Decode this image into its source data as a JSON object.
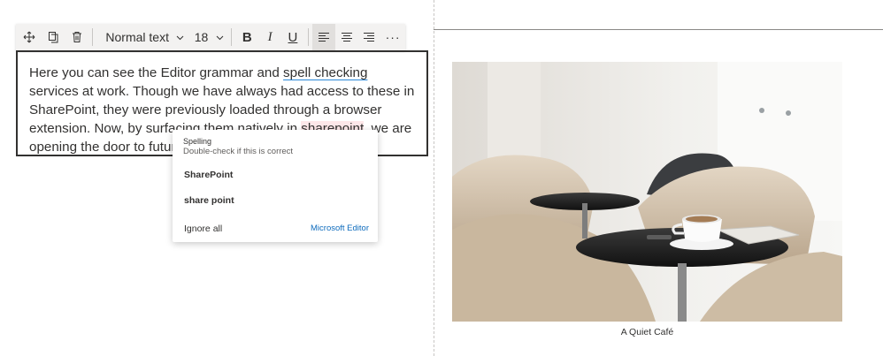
{
  "toolbar": {
    "move_icon": "move-icon",
    "duplicate_icon": "duplicate-icon",
    "delete_icon": "trash-icon",
    "text_style": "Normal text",
    "font_size": "18",
    "bold": "B",
    "italic": "I",
    "underline": "U",
    "more": "···",
    "active_alignment": "left"
  },
  "editor": {
    "before_spell_ok": "Here you can see the Editor grammar and ",
    "spell_ok_word": "spell checking",
    "middle": " services at work. Though we have always had access to these in SharePoint, they were previously loaded through a browser extension. Now, by surfacing them natively in ",
    "misspelled_word": "sharepoint",
    "after": ", we are opening the door to future text refinements."
  },
  "spelling_popup": {
    "category": "Spelling",
    "hint": "Double-check if this is correct",
    "suggestions": [
      "SharePoint",
      "share point"
    ],
    "ignore_label": "Ignore all",
    "brand": "Microsoft Editor"
  },
  "image": {
    "caption": "A Quiet Café"
  },
  "colors": {
    "accent_link": "#0f6cbd",
    "misspell_underline": "#d13438",
    "spell_ok_underline": "#2b88d8"
  }
}
